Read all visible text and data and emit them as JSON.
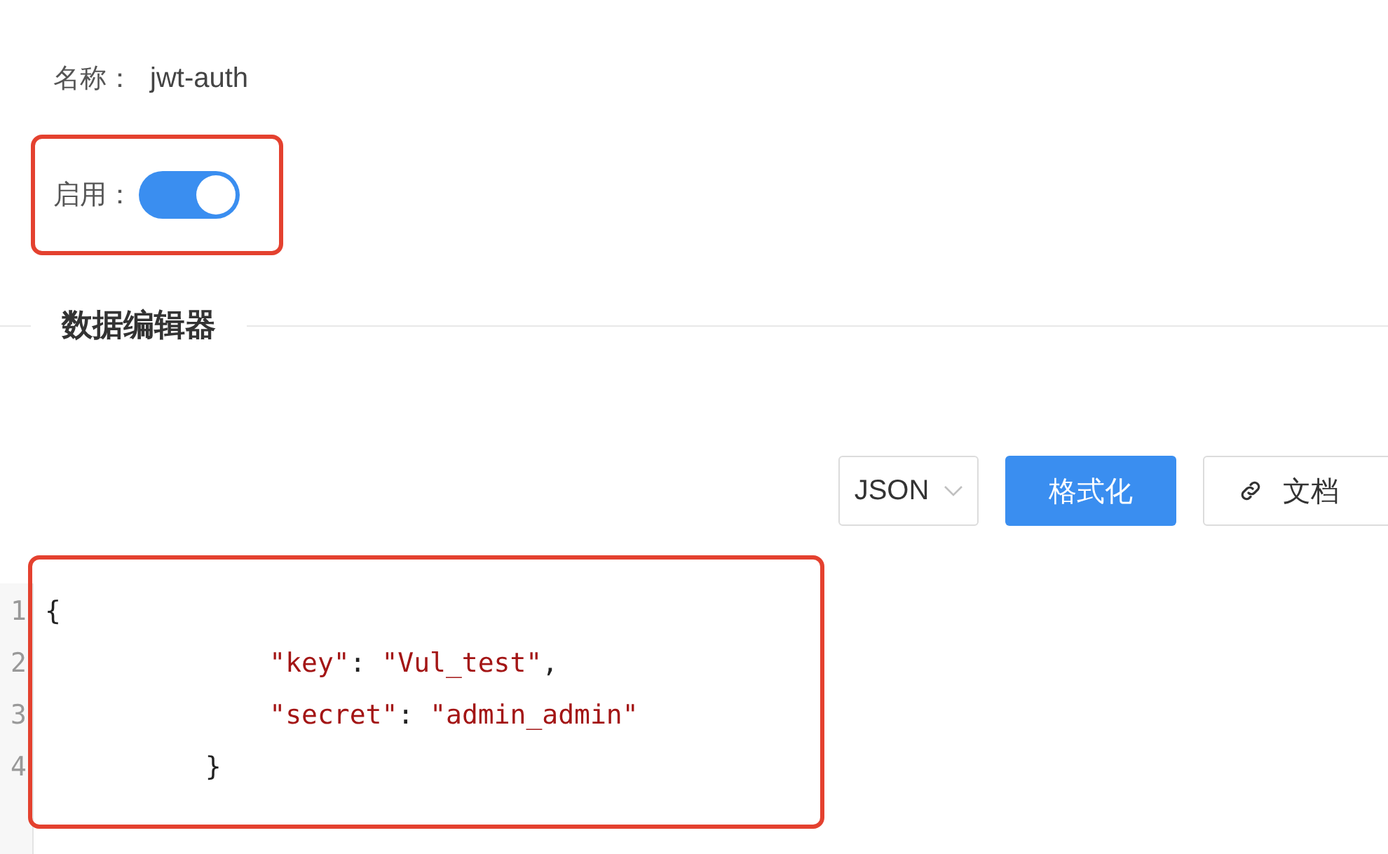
{
  "name_field": {
    "label": "名称：",
    "value": "jwt-auth"
  },
  "enable_field": {
    "label": "启用：",
    "on": true
  },
  "section_title": "数据编辑器",
  "toolbar": {
    "format_select": "JSON",
    "format_button": "格式化",
    "docs_button": "文档"
  },
  "editor": {
    "lines": [
      {
        "number": "1",
        "tokens": [
          {
            "kind": "punct",
            "text": "{"
          }
        ]
      },
      {
        "number": "2",
        "tokens": [
          {
            "kind": "key",
            "text": "              \"key\""
          },
          {
            "kind": "punct",
            "text": ": "
          },
          {
            "kind": "string",
            "text": "\"Vul_test\""
          },
          {
            "kind": "punct",
            "text": ","
          }
        ]
      },
      {
        "number": "3",
        "tokens": [
          {
            "kind": "key",
            "text": "              \"secret\""
          },
          {
            "kind": "punct",
            "text": ": "
          },
          {
            "kind": "string",
            "text": "\"admin_admin\""
          }
        ]
      },
      {
        "number": "4",
        "tokens": [
          {
            "kind": "punct",
            "text": "          }"
          }
        ]
      }
    ]
  }
}
